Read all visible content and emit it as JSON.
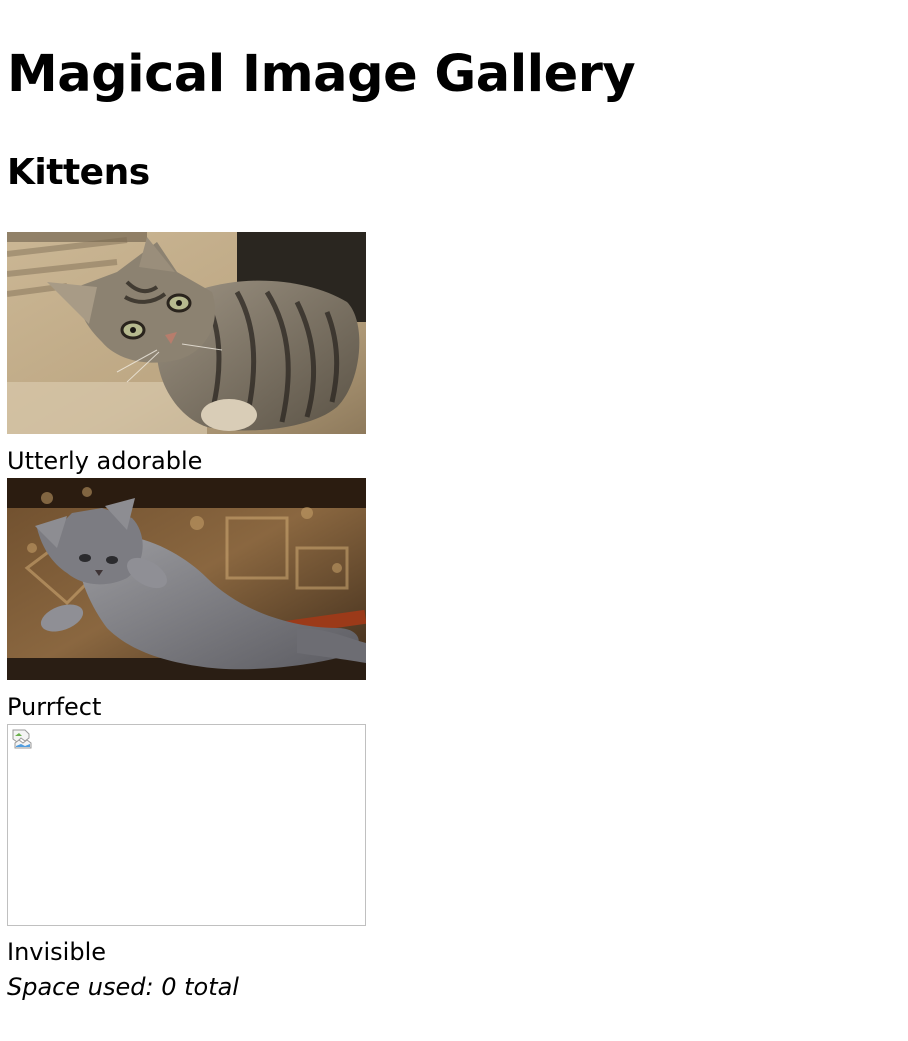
{
  "page": {
    "title": "Magical Image Gallery"
  },
  "section": {
    "heading": "Kittens"
  },
  "gallery": {
    "items": [
      {
        "caption": "Utterly adorable",
        "image": "tabby-kitten-lying"
      },
      {
        "caption": "Purrfect",
        "image": "grey-kitten-playing"
      },
      {
        "caption": "Invisible",
        "image": "broken-image-icon"
      }
    ]
  },
  "footer": {
    "space_used": "Space used: 0 total"
  }
}
